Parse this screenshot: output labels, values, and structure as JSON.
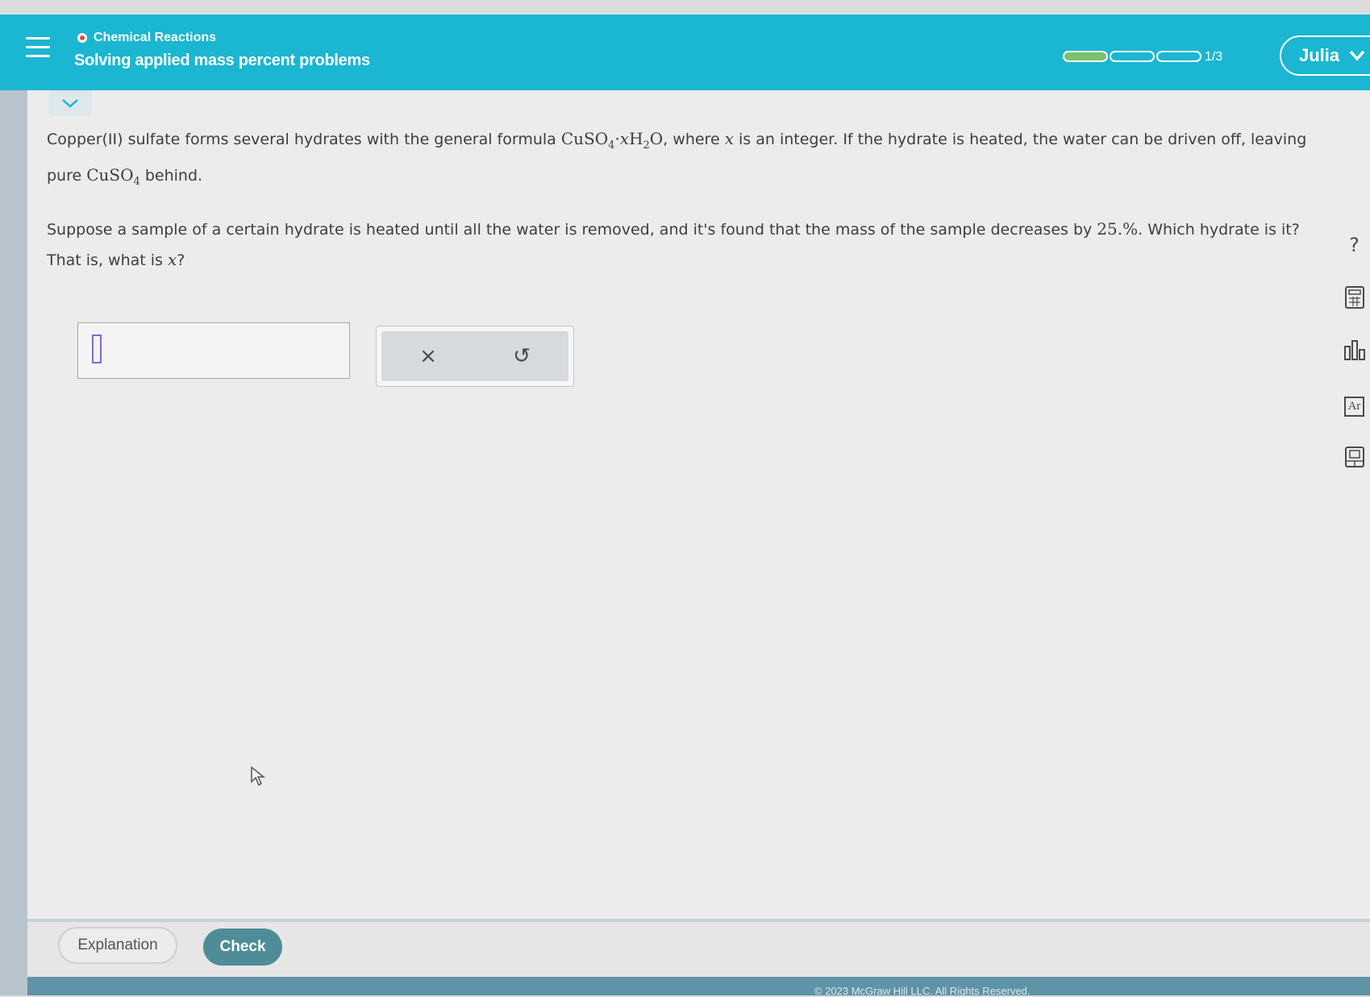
{
  "header": {
    "topic": "Chemical Reactions",
    "title": "Solving applied mass percent problems",
    "progress": {
      "completed": 1,
      "total": 3,
      "label": "1/3"
    },
    "user": "Julia"
  },
  "question": {
    "p1_a": "Copper(II) sulfate forms several hydrates with the general formula ",
    "p1_b": ", where ",
    "p1_c": " is an integer. If the hydrate is heated, the water can be driven off, leaving pure ",
    "p1_d": " behind.",
    "p2_a": "Suppose a sample of a certain hydrate is heated until all the water is removed, and it's found that the mass of the sample decreases by ",
    "p2_value": "25.%",
    "p2_b": ". Which hydrate is it? That is, what is ",
    "p2_c": "?",
    "var": "x",
    "formula": {
      "cu": "CuSO",
      "sub4": "4",
      "dot": "·",
      "x": "x",
      "h": "H",
      "sub2": "2",
      "o": "O"
    }
  },
  "tools": {
    "clear": "×",
    "undo": "↺"
  },
  "side_tools": [
    "?",
    "calculator-icon",
    "chart-icon",
    "periodic-table-icon",
    "reference-icon"
  ],
  "side_tools_labels": {
    "help": "?",
    "periodic": "Ar"
  },
  "footer": {
    "explanation": "Explanation",
    "check": "Check",
    "copyright": "© 2023 McGraw Hill LLC. All Rights Reserved."
  }
}
